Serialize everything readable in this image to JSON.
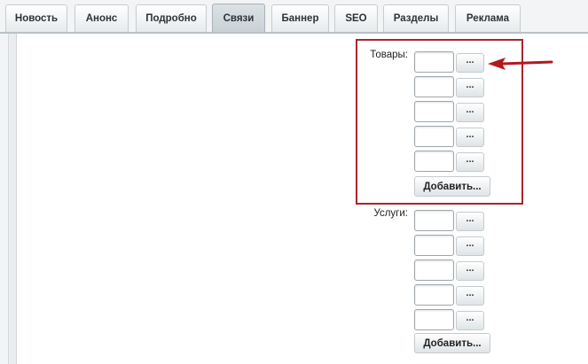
{
  "tabs": [
    {
      "label": "Новость",
      "active": false
    },
    {
      "label": "Анонс",
      "active": false
    },
    {
      "label": "Подробно",
      "active": false
    },
    {
      "label": "Связи",
      "active": true
    },
    {
      "label": "Баннер",
      "active": false
    },
    {
      "label": "SEO",
      "active": false
    },
    {
      "label": "Разделы",
      "active": false
    },
    {
      "label": "Реклама",
      "active": false
    }
  ],
  "goods": {
    "label": "Товары:",
    "rows": [
      {
        "value": "",
        "button": "..."
      },
      {
        "value": "",
        "button": "..."
      },
      {
        "value": "",
        "button": "..."
      },
      {
        "value": "",
        "button": "..."
      },
      {
        "value": "",
        "button": "..."
      }
    ],
    "add_label": "Добавить..."
  },
  "services": {
    "label": "Услуги:",
    "rows": [
      {
        "value": "",
        "button": "..."
      },
      {
        "value": "",
        "button": "..."
      },
      {
        "value": "",
        "button": "..."
      },
      {
        "value": "",
        "button": "..."
      },
      {
        "value": "",
        "button": "..."
      }
    ],
    "add_label": "Добавить..."
  },
  "annotation": {
    "highlight_color": "#a8262c",
    "arrow_color": "#b3181e"
  }
}
